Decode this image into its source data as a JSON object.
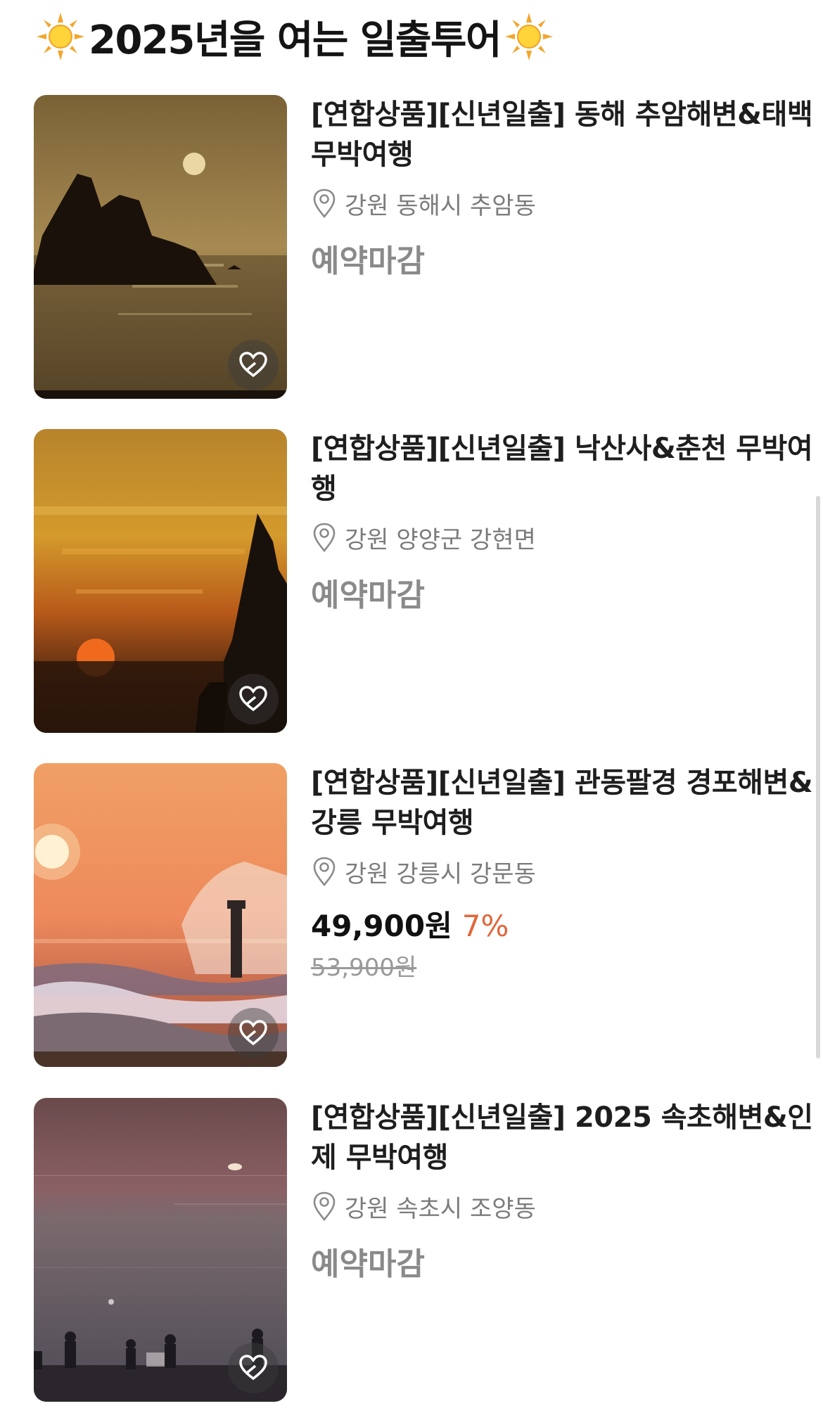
{
  "section": {
    "title": "2025년을 여는 일출투어",
    "left_icon": "sun-emoji",
    "right_icon": "sun-emoji"
  },
  "products": [
    {
      "name": "[연합상품][신년일출] 동해 추암해변&태백 무박여행",
      "location": "강원 동해시 추암동",
      "status": "예약마감",
      "image": "rock-sunrise-sea"
    },
    {
      "name": "[연합상품][신년일출] 낙산사&춘천 무박여행",
      "location": "강원 양양군 강현면",
      "status": "예약마감",
      "image": "orange-sunrise-trees"
    },
    {
      "name": "[연합상품][신년일출] 관동팔경 경포해변&강릉 무박여행",
      "location": "강원 강릉시 강문동",
      "price": "49,900원",
      "discount": "7%",
      "original_price": "53,900원",
      "image": "sunrise-waves-lighthouse"
    },
    {
      "name": "[연합상품][신년일출] 2025 속초해변&인제 무박여행",
      "location": "강원 속초시 조양동",
      "status": "예약마감",
      "image": "beach-sunrise-crowd"
    }
  ],
  "icons": {
    "wishlist": "heart-add-icon",
    "location": "location-pin-icon"
  },
  "colors": {
    "discount": "#e0673b",
    "closed": "#8a8a8a",
    "location": "#7c7c7c"
  }
}
